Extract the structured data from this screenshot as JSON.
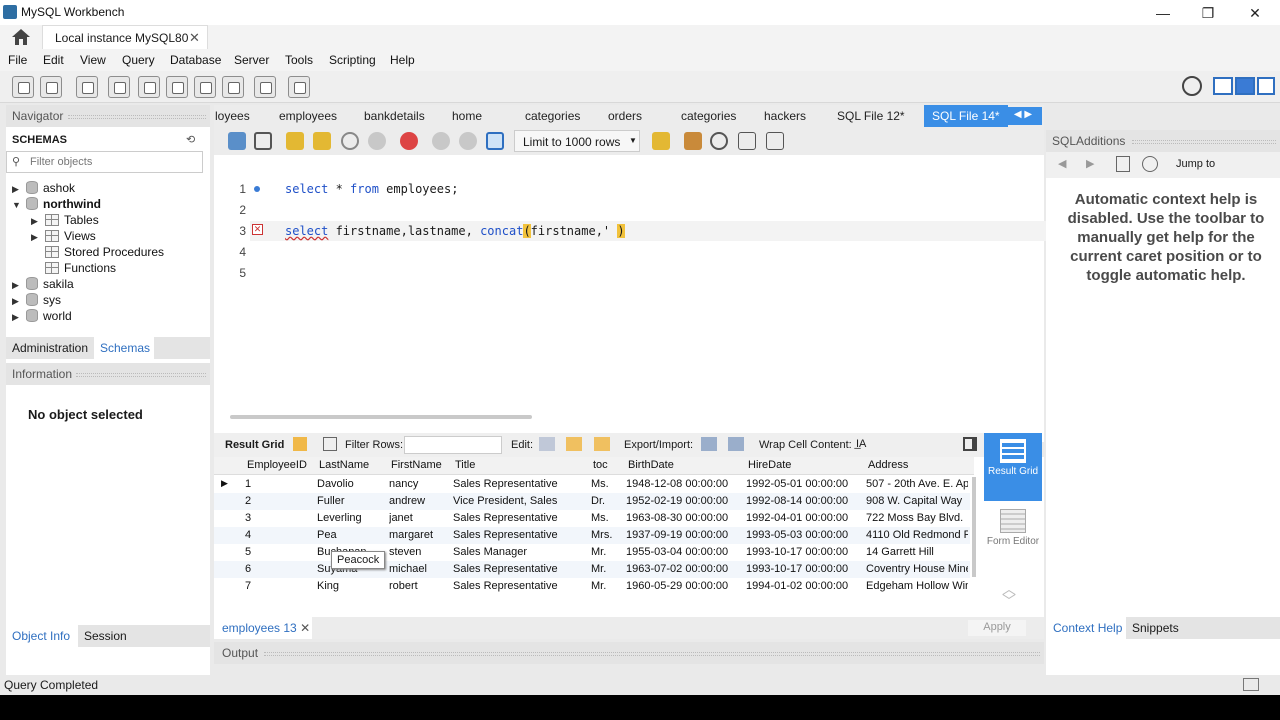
{
  "window": {
    "title": "MySQL Workbench",
    "minimize": "—",
    "restore": "❐",
    "close": "✕"
  },
  "connection_tab": {
    "label": "Local instance MySQL80",
    "close": "✕"
  },
  "menu": [
    "File",
    "Edit",
    "View",
    "Query",
    "Database",
    "Server",
    "Tools",
    "Scripting",
    "Help"
  ],
  "navigator": {
    "title": "Navigator",
    "schemas_label": "SCHEMAS",
    "filter_placeholder": "Filter objects",
    "schemas": [
      "ashok",
      "northwind",
      "sakila",
      "sys",
      "world"
    ],
    "northwind_children": [
      "Tables",
      "Views",
      "Stored Procedures",
      "Functions"
    ],
    "tabs": [
      "Administration",
      "Schemas"
    ],
    "information_title": "Information",
    "no_object": "No object selected",
    "bottom_tabs": [
      "Object Info",
      "Session"
    ]
  },
  "sql_tabs": [
    "loyees",
    "employees",
    "bankdetails",
    "home",
    "categories",
    "orders",
    "categories",
    "hackers",
    "SQL File 12*",
    "SQL File 14*"
  ],
  "limit_select": "Limit to 1000 rows",
  "editor": {
    "line_numbers": [
      "1",
      "2",
      "3",
      "4",
      "5"
    ],
    "line1": {
      "kw1": "select",
      "rest1": " * ",
      "kw2": "from",
      "rest2": " employees;"
    },
    "line3": {
      "kw1": "select",
      "rest1": " firstname,lastname, ",
      "fn": "concat",
      "paren": "(",
      "rest2": "firstname,' ",
      "close": ")"
    }
  },
  "result_bar": {
    "result_grid": "Result Grid",
    "filter_rows": "Filter Rows:",
    "edit": "Edit:",
    "export": "Export/Import:",
    "wrap": "Wrap Cell Content:"
  },
  "grid": {
    "columns": [
      "EmployeeID",
      "LastName",
      "FirstName",
      "Title",
      "toc",
      "BirthDate",
      "HireDate",
      "Address"
    ],
    "rows": [
      [
        "1",
        "Davolio",
        "nancy",
        "Sales Representative",
        "Ms.",
        "1948-12-08 00:00:00",
        "1992-05-01 00:00:00",
        "507 - 20th Ave. E. Ap"
      ],
      [
        "2",
        "Fuller",
        "andrew",
        "Vice President, Sales",
        "Dr.",
        "1952-02-19 00:00:00",
        "1992-08-14 00:00:00",
        "908 W. Capital Way"
      ],
      [
        "3",
        "Leverling",
        "janet",
        "Sales Representative",
        "Ms.",
        "1963-08-30 00:00:00",
        "1992-04-01 00:00:00",
        "722 Moss Bay Blvd."
      ],
      [
        "4",
        "Pea",
        "margaret",
        "Sales Representative",
        "Mrs.",
        "1937-09-19 00:00:00",
        "1993-05-03 00:00:00",
        "4110 Old Redmond R"
      ],
      [
        "5",
        "Buchanan",
        "steven",
        "Sales Manager",
        "Mr.",
        "1955-03-04 00:00:00",
        "1993-10-17 00:00:00",
        "14 Garrett Hill"
      ],
      [
        "6",
        "Suyama",
        "michael",
        "Sales Representative",
        "Mr.",
        "1963-07-02 00:00:00",
        "1993-10-17 00:00:00",
        "Coventry House Mine"
      ],
      [
        "7",
        "King",
        "robert",
        "Sales Representative",
        "Mr.",
        "1960-05-29 00:00:00",
        "1994-01-02 00:00:00",
        "Edgeham Hollow Wind"
      ]
    ],
    "tooltip": "Peacock"
  },
  "side_buttons": {
    "result_grid": "Result Grid",
    "form_editor": "Form Editor"
  },
  "result_tab": {
    "label": "employees 13",
    "close": "✕",
    "apply": "Apply"
  },
  "output_label": "Output",
  "sql_additions": {
    "title": "SQLAdditions",
    "jump_to": "Jump to",
    "help_text": "Automatic context help is disabled. Use the toolbar to manually get help for the current caret position or to toggle automatic help.",
    "tabs": [
      "Context Help",
      "Snippets"
    ]
  },
  "status": "Query Completed"
}
